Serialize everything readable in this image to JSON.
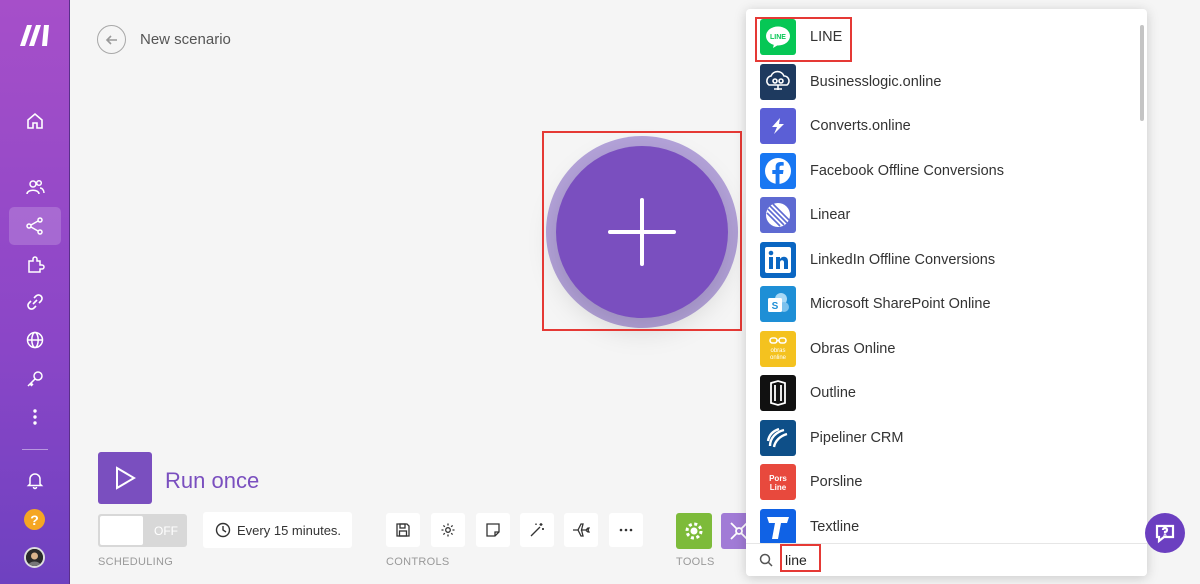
{
  "header": {
    "title": "New scenario"
  },
  "sidebar": {
    "items": [
      {
        "icon": "home-icon"
      },
      {
        "icon": "users-icon"
      },
      {
        "icon": "share-icon"
      },
      {
        "icon": "puzzle-icon"
      },
      {
        "icon": "link-icon"
      },
      {
        "icon": "globe-icon"
      },
      {
        "icon": "key-icon"
      },
      {
        "icon": "more-vertical-icon"
      },
      {
        "icon": "bell-icon"
      },
      {
        "icon": "help-icon",
        "label": "?"
      }
    ]
  },
  "toolbar": {
    "run_label": "Run once",
    "toggle_label": "OFF",
    "schedule_label": "Every 15 minutes.",
    "scheduling_section": "SCHEDULING",
    "controls_section": "CONTROLS",
    "tools_section": "TOOLS"
  },
  "app_panel": {
    "apps": [
      {
        "name": "LINE",
        "color": "#06c755"
      },
      {
        "name": "Businesslogic.online",
        "color": "#1e3a5f"
      },
      {
        "name": "Converts.online",
        "color": "#5b5fd6"
      },
      {
        "name": "Facebook Offline Conversions",
        "color": "#1877f2"
      },
      {
        "name": "Linear",
        "color": "#5e6ad2"
      },
      {
        "name": "LinkedIn Offline Conversions",
        "color": "#0a66c2"
      },
      {
        "name": "Microsoft SharePoint Online",
        "color": "#1e8fd6"
      },
      {
        "name": "Obras Online",
        "color": "#f4c21f"
      },
      {
        "name": "Outline",
        "color": "#111111"
      },
      {
        "name": "Pipeliner CRM",
        "color": "#0e4f88"
      },
      {
        "name": "Porsline",
        "color": "#e8493d"
      },
      {
        "name": "Textline",
        "color": "#1062e5"
      }
    ],
    "search_value": "line"
  },
  "colors": {
    "accent": "#7a4fbf",
    "highlight": "#e53935"
  }
}
